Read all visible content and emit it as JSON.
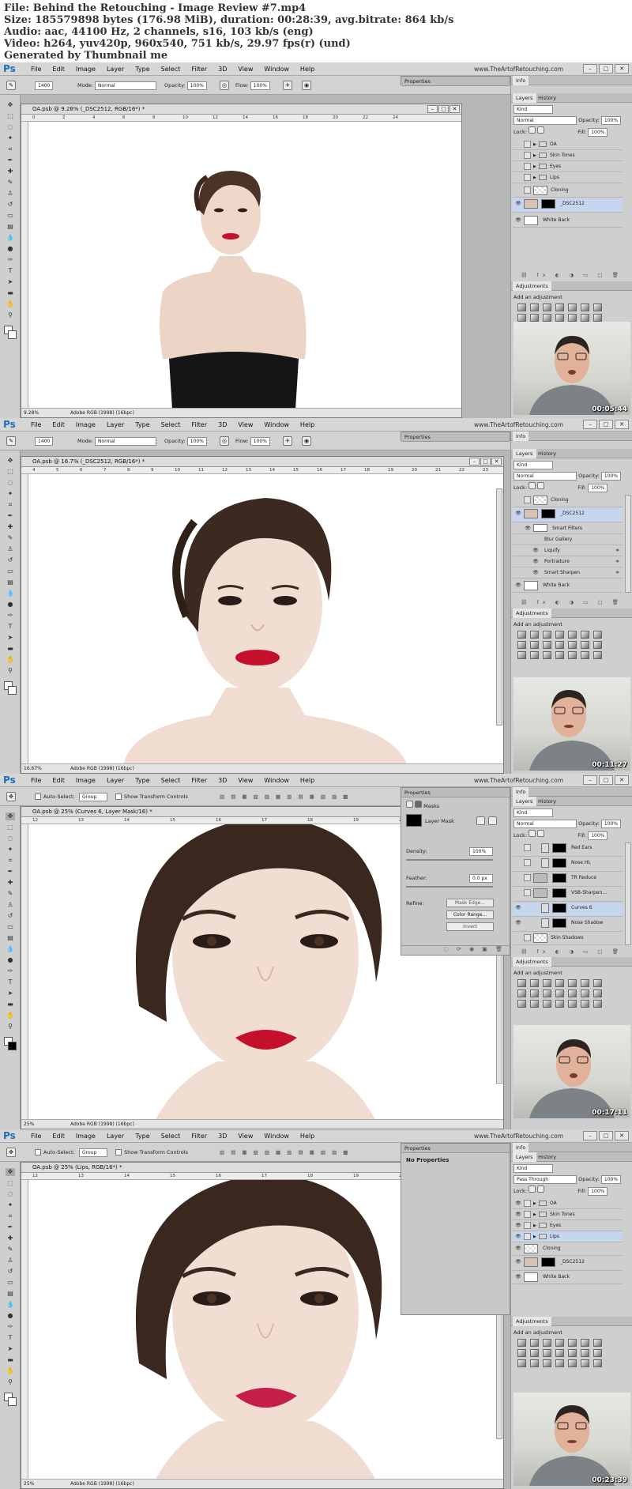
{
  "header": {
    "file": "File: Behind the Retouching - Image Review #7.mp4",
    "size": "Size: 185579898 bytes (176.98 MiB), duration: 00:28:39, avg.bitrate: 864 kb/s",
    "audio": "Audio: aac, 44100 Hz, 2 channels, s16, 103 kb/s (eng)",
    "video": "Video: h264, yuv420p, 960x540, 751 kb/s, 29.97 fps(r) (und)",
    "generated": "Generated by Thumbnail me"
  },
  "app": {
    "logo": "Ps",
    "menu": [
      "File",
      "Edit",
      "Image",
      "Layer",
      "Type",
      "Select",
      "Filter",
      "3D",
      "View",
      "Window",
      "Help"
    ],
    "site": "www.TheArtofRetouching.com",
    "win_min": "–",
    "win_max": "□",
    "win_close": "✕"
  },
  "colors": {
    "selected_layer": "#c7d6ef",
    "app_bg": "#b7b7b7",
    "lips": "#c4102a"
  },
  "frames": [
    {
      "brush_size": "1400",
      "mode_label": "Mode:",
      "mode": "Normal",
      "opacity_label": "Opacity:",
      "opacity": "100%",
      "flow_label": "Flow:",
      "flow": "100%",
      "props_tab": "Properties",
      "doc_title": "OA.psb @ 9.28% (_DSC2512, RGB/16*) *",
      "zoom": "9.28%",
      "profile": "Adobe RGB (1998) (16bpc)",
      "panel_tabs": [
        "Layers",
        "History"
      ],
      "top_tab": "Info",
      "kind": "Kind",
      "blend": "Normal",
      "panel_opacity_label": "Opacity:",
      "panel_opacity": "100%",
      "lock_label": "Lock:",
      "fill_label": "Fill:",
      "fill": "100%",
      "layers": [
        "OA",
        "Skin Tones",
        "Eyes",
        "Lips",
        "Cloning",
        "_DSC2512",
        "White Back"
      ],
      "adj_title": "Adjustments",
      "adj_sub": "Add an adjustment",
      "timestamp": "00:05:44"
    },
    {
      "brush_size": "1400",
      "mode_label": "Mode:",
      "mode": "Normal",
      "opacity_label": "Opacity:",
      "opacity": "100%",
      "flow_label": "Flow:",
      "flow": "100%",
      "props_tab": "Properties",
      "doc_title": "OA.psb @ 16.7% (_DSC2512, RGB/16*) *",
      "zoom": "16.67%",
      "profile": "Adobe RGB (1998) (16bpc)",
      "panel_tabs": [
        "Layers",
        "History"
      ],
      "top_tab": "Info",
      "kind": "Kind",
      "blend": "Normal",
      "panel_opacity_label": "Opacity:",
      "panel_opacity": "100%",
      "lock_label": "Lock:",
      "fill_label": "Fill:",
      "fill": "100%",
      "layers": [
        "Cloning",
        "_DSC2512",
        "Smart Filters",
        "Blur Gallery",
        "Liquify",
        "Portraiture",
        "Smart Sharpen",
        "White Back"
      ],
      "adj_title": "Adjustments",
      "adj_sub": "Add an adjustment",
      "timestamp": "00:11:27"
    },
    {
      "auto_select": "Auto-Select:",
      "group": "Group",
      "transform": "Show Transform Controls",
      "doc_title": "OA.psb @ 25% (Curves 6, Layer Mask/16) *",
      "zoom": "25%",
      "profile": "Adobe RGB (1998) (16bpc)",
      "props_tab": "Properties",
      "masks": "Masks",
      "layer_mask": "Layer Mask",
      "density_label": "Density:",
      "density": "100%",
      "feather_label": "Feather:",
      "feather": "0.0 px",
      "refine_label": "Refine:",
      "mask_edge": "Mask Edge...",
      "color_range": "Color Range...",
      "invert": "Invert",
      "panel_tabs": [
        "Layers",
        "History"
      ],
      "top_tab": "Info",
      "kind": "Kind",
      "blend": "Normal",
      "panel_opacity_label": "Opacity:",
      "panel_opacity": "100%",
      "lock_label": "Lock:",
      "fill_label": "Fill:",
      "fill": "100%",
      "layers": [
        "Red Ears",
        "Nose HL",
        "TR Reduce",
        "VSB-Sharpen...",
        "Curves 6",
        "Nose Shadow",
        "Skin Shadows"
      ],
      "adj_title": "Adjustments",
      "adj_sub": "Add an adjustment",
      "timestamp": "00:17:11"
    },
    {
      "auto_select": "Auto-Select:",
      "group": "Group",
      "transform": "Show Transform Controls",
      "doc_title": "OA.psb @ 25% (Lips, RGB/16*) *",
      "zoom": "25%",
      "profile": "Adobe RGB (1998) (16bpc)",
      "props_tab": "Properties",
      "no_props": "No Properties",
      "panel_tabs": [
        "Layers",
        "History"
      ],
      "top_tab": "Info",
      "kind": "Kind",
      "blend": "Pass Through",
      "panel_opacity_label": "Opacity:",
      "panel_opacity": "100%",
      "lock_label": "Lock:",
      "fill_label": "Fill:",
      "fill": "100%",
      "layers": [
        "OA",
        "Skin Tones",
        "Eyes",
        "Lips",
        "Cloning",
        "_DSC2512",
        "White Back"
      ],
      "adj_title": "Adjustments",
      "adj_sub": "Add an adjustment",
      "timestamp": "00:23:39"
    }
  ],
  "rulers": {
    "f1h": [
      "0",
      "2",
      "4",
      "6",
      "8",
      "10",
      "12",
      "14",
      "16",
      "18",
      "20",
      "22",
      "24"
    ],
    "f2h": [
      "4",
      "5",
      "6",
      "7",
      "8",
      "9",
      "10",
      "11",
      "12",
      "13",
      "14",
      "15",
      "16",
      "17",
      "18",
      "19",
      "20",
      "21",
      "22",
      "23"
    ],
    "f3h": [
      "12",
      "13",
      "14",
      "15",
      "16",
      "17",
      "18",
      "19",
      "20",
      "21"
    ],
    "f4h": [
      "12",
      "13",
      "14",
      "15",
      "16",
      "17",
      "18",
      "19",
      "20",
      "21"
    ]
  }
}
